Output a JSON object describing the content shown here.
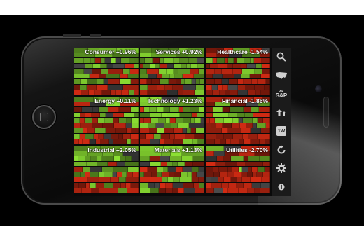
{
  "sectors": [
    {
      "label": "Consumer +0.96%",
      "trend": "up"
    },
    {
      "label": "Services +0.92%",
      "trend": "up"
    },
    {
      "label": "Healthcare -1.54%",
      "trend": "down"
    },
    {
      "label": "Energy +0.11%",
      "trend": "mixed"
    },
    {
      "label": "Technology +1.23%",
      "trend": "up"
    },
    {
      "label": "Financial -1.86%",
      "trend": "down"
    },
    {
      "label": "Industrial +2.05%",
      "trend": "up"
    },
    {
      "label": "Materials +1.13%",
      "trend": "up"
    },
    {
      "label": "Utilities -2.70%",
      "trend": "down"
    }
  ],
  "toolbar": {
    "vs_label": "vs.",
    "sp_label": "S&P",
    "week_label": "1W",
    "icons": [
      "search-icon",
      "us-map-icon",
      "vs-sp-icon",
      "sort-icon",
      "week-icon",
      "refresh-icon",
      "settings-icon",
      "info-icon"
    ]
  },
  "colors": {
    "green": "#7fcc2e",
    "red": "#b02410",
    "neutral": "#3a3a3a"
  }
}
